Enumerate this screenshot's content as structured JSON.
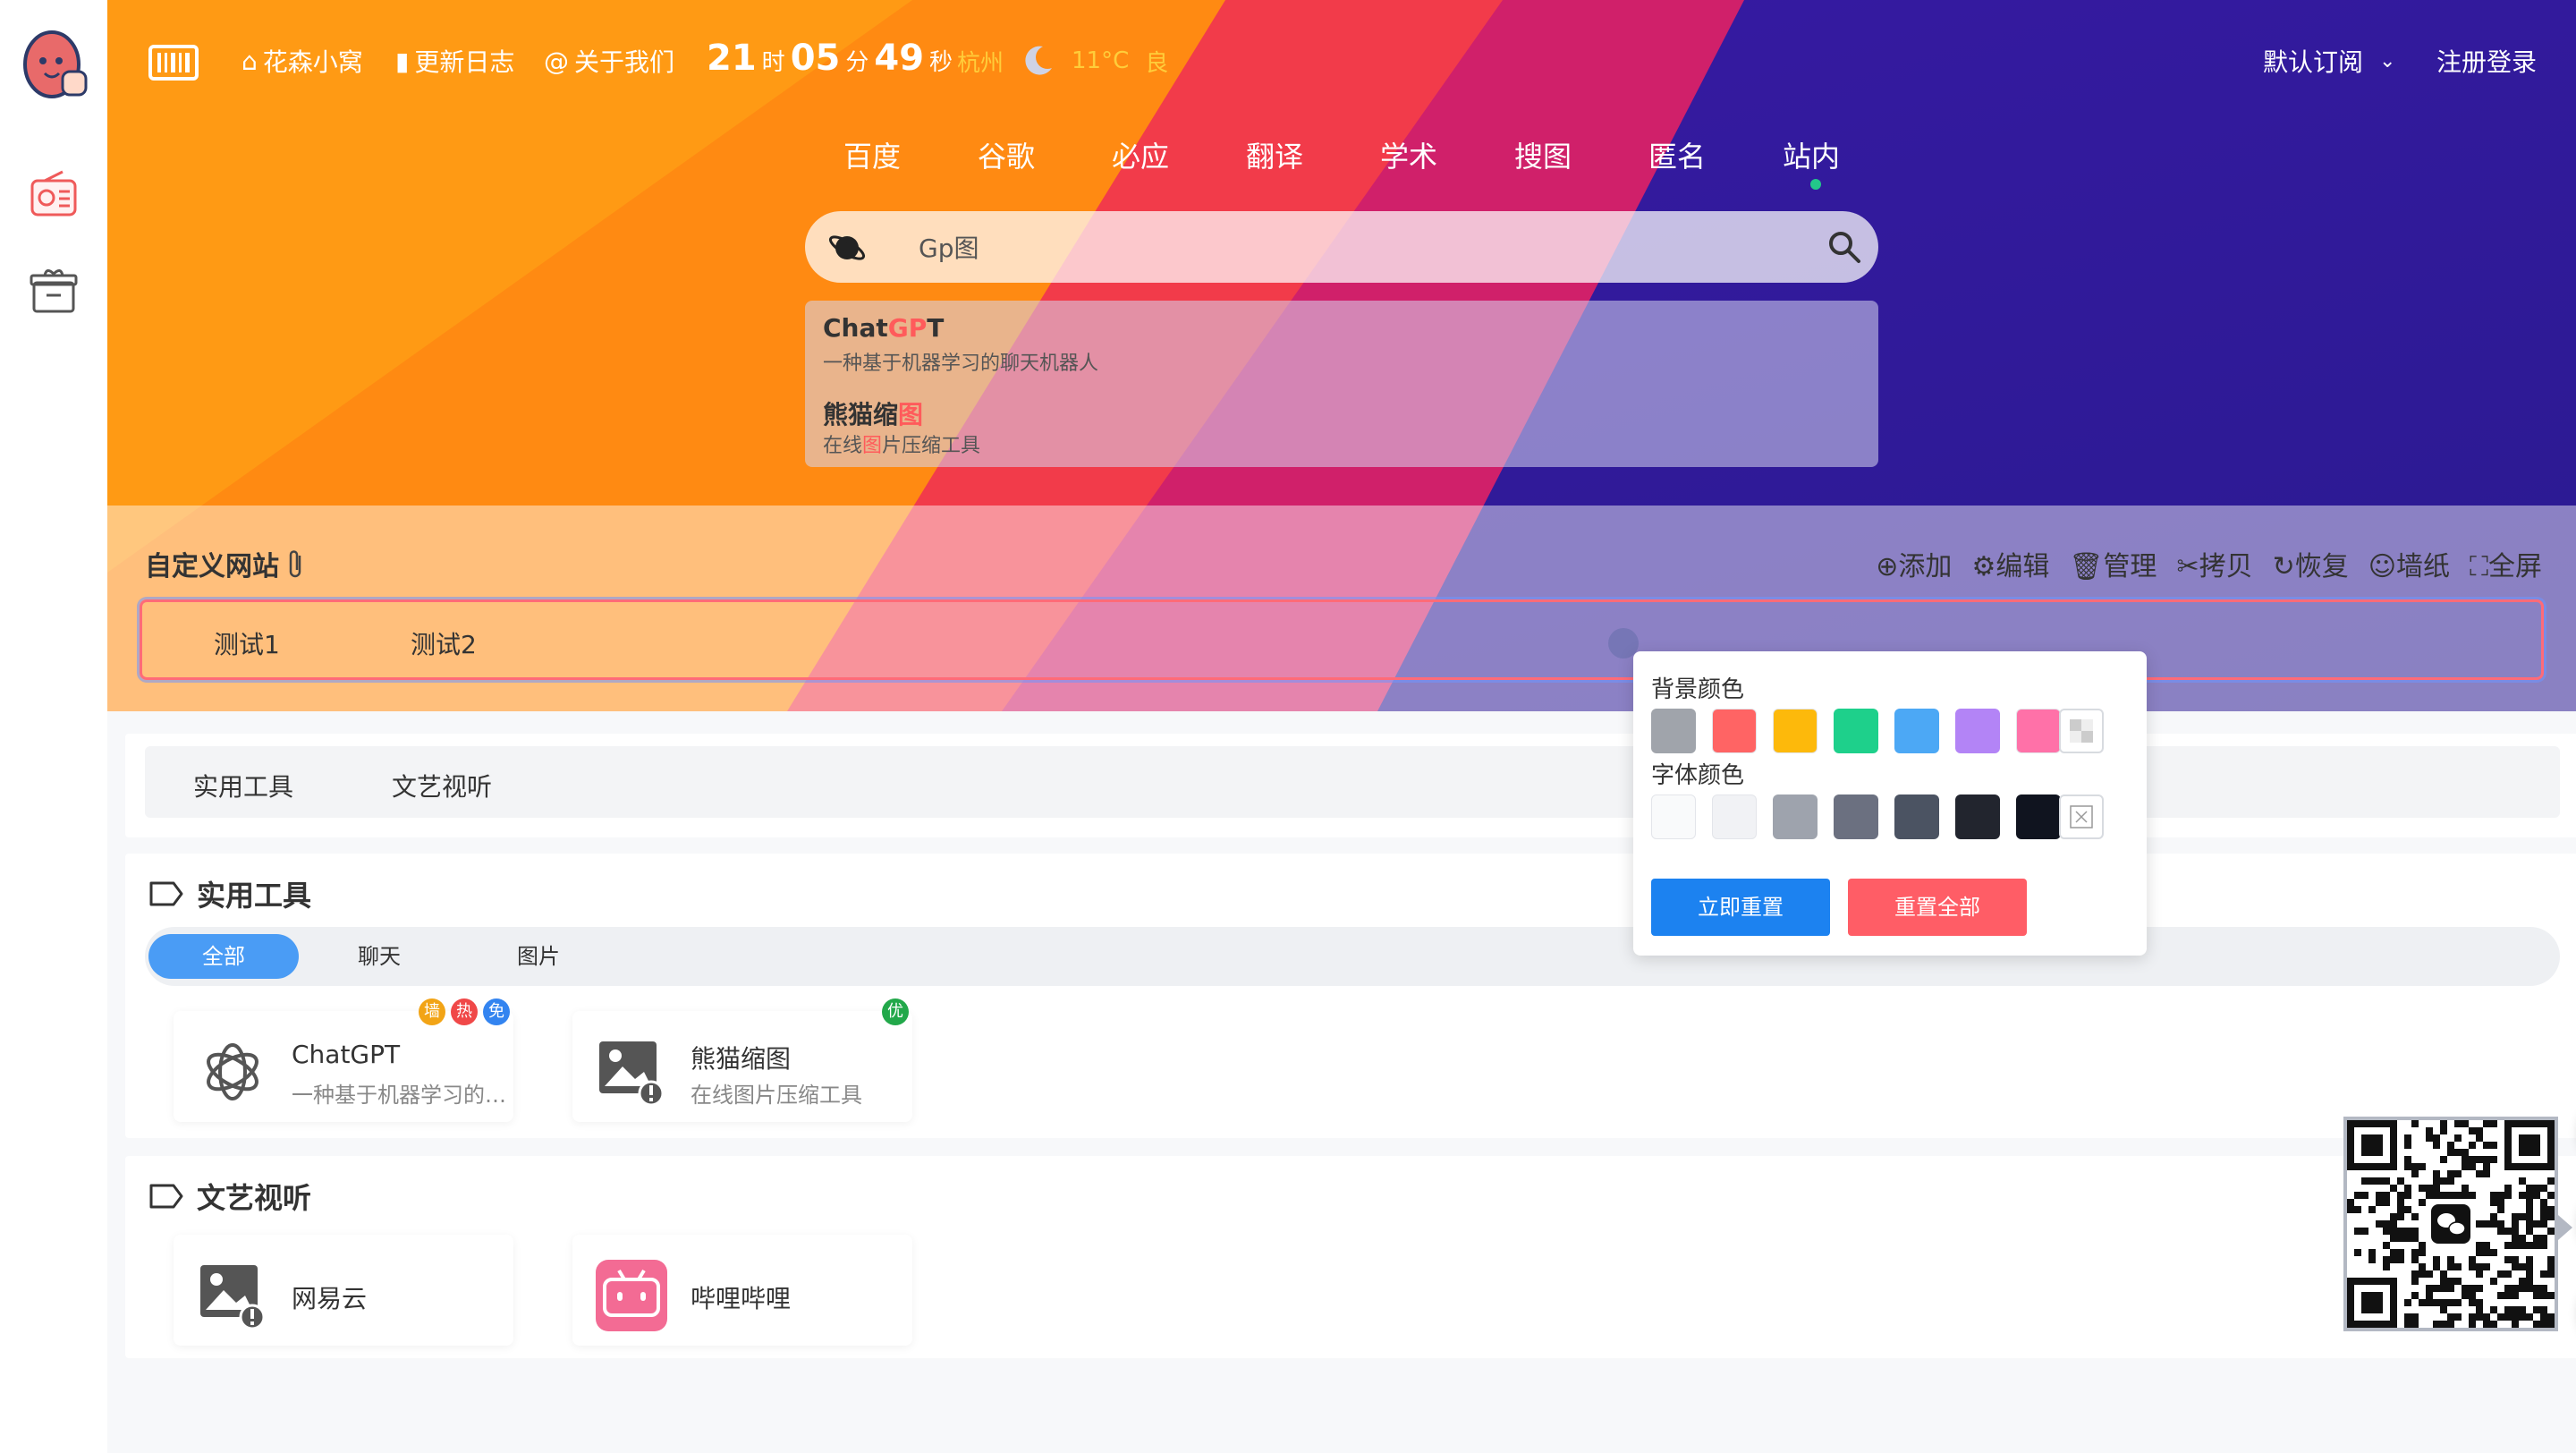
{
  "topbar": {
    "nav": [
      {
        "label": "花森小窝",
        "icon": "home-icon"
      },
      {
        "label": "更新日志",
        "icon": "bar-chart-icon"
      },
      {
        "label": "关于我们",
        "icon": "at-icon"
      }
    ],
    "clock": {
      "hour": "21",
      "hour_unit": "时",
      "minute": "05",
      "minute_unit": "分",
      "second": "49",
      "second_unit": "秒"
    },
    "weather": {
      "city": "杭州",
      "temp": "11°C",
      "aqi": "良"
    },
    "subscribe": "默认订阅",
    "login": "注册登录"
  },
  "engines": [
    "百度",
    "谷歌",
    "必应",
    "翻译",
    "学术",
    "搜图",
    "匿名",
    "站内"
  ],
  "active_engine": "站内",
  "search": {
    "value": "Gp图"
  },
  "suggestions": [
    {
      "title_pre": "Chat",
      "title_hl": "GP",
      "title_post": "T",
      "desc": "一种基于机器学习的聊天机器人"
    },
    {
      "title_pre": "熊猫缩",
      "title_hl": "图",
      "title_post": "",
      "desc_pre": "在线",
      "desc_hl": "图",
      "desc_post": "片压缩工具"
    }
  ],
  "custom": {
    "title": "自定义网站",
    "actions": [
      "⊕添加",
      "⚙编辑",
      "🗑管理",
      "✂拷贝",
      "↻恢复",
      "☺墙纸",
      "⛶全屏"
    ],
    "sites": [
      "测试1",
      "测试2"
    ]
  },
  "category_tabs": [
    "实用工具",
    "文艺视听"
  ],
  "sections": [
    {
      "title": "实用工具",
      "pills": [
        "全部",
        "聊天",
        "图片"
      ],
      "sites": [
        {
          "name": "ChatGPT",
          "desc": "一种基于机器学习的聊天机器人",
          "badges": [
            "墙",
            "热",
            "免"
          ]
        },
        {
          "name": "熊猫缩图",
          "desc": "在线图片压缩工具",
          "badges": [
            "优"
          ]
        }
      ]
    },
    {
      "title": "文艺视听",
      "sites": [
        {
          "name": "网易云"
        },
        {
          "name": "哔哩哔哩"
        }
      ]
    }
  ],
  "popover": {
    "bg_label": "背景颜色",
    "font_label": "字体颜色",
    "bg_colors": [
      "#a0a4ab",
      "#ff6464",
      "#fdb90b",
      "#1ed08b",
      "#4ca8f5",
      "#b384f6",
      "#ff71a8"
    ],
    "font_colors": [
      "#f9fafb",
      "#f1f2f5",
      "#9ea3ad",
      "#6b7080",
      "#4b5362",
      "#22252e",
      "#10141f"
    ],
    "reset_now": "立即重置",
    "reset_all": "重置全部"
  },
  "colors": {
    "accent": "#4a9cf5",
    "danger": "#ff5d66",
    "primary_btn": "#1c82f0"
  }
}
